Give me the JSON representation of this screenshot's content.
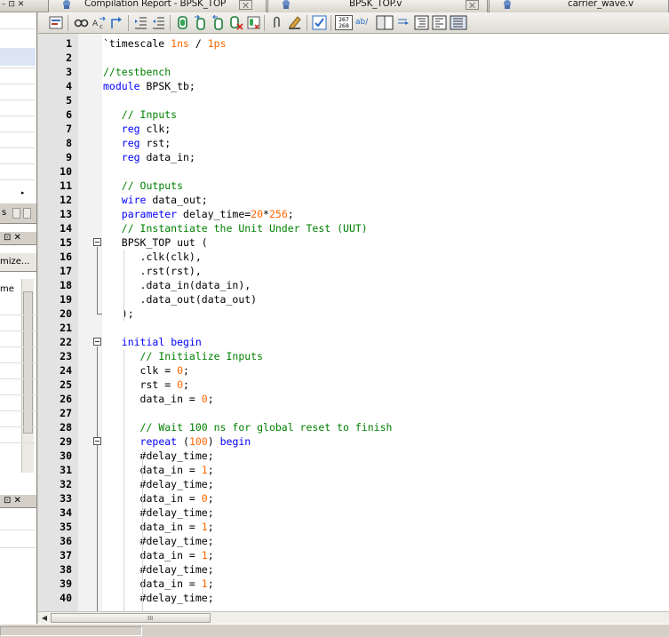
{
  "left_panel": {
    "header_controls": "– ⊡ ✕",
    "tab_fragment": "s",
    "pane2_controls": "⊡ ✕",
    "customize_label": "mize...",
    "column_header": "me",
    "pane3_controls": "⊡ ✕"
  },
  "tabs": [
    {
      "label": "Compilation Report - BPSK_TOP",
      "icon": "report-icon",
      "closable": true
    },
    {
      "label": "BPSK_TOP.v",
      "icon": "verilog-file-icon",
      "closable": true
    },
    {
      "label": "carrier_wave.v",
      "icon": "verilog-file-icon",
      "closable": false
    }
  ],
  "toolbar": {
    "buttons": [
      "insert-template-icon",
      "find-icon",
      "find-replace-icon",
      "goto-line-icon",
      "increase-indent-icon",
      "decrease-indent-icon",
      "bookmark-toggle-icon",
      "bookmark-next-icon",
      "bookmark-prev-icon",
      "bookmark-clear-icon",
      "bookmark-list-icon",
      "attach-icon",
      "comment-icon",
      "check-syntax-icon",
      "line-numbers-icon",
      "spell-check-icon",
      "split-view-icon",
      "wrap-icon",
      "indent-guide-icon",
      "view-mode-icon"
    ],
    "line_numbers_top": "267",
    "line_numbers_bottom": "268",
    "spell_label": "ab/"
  },
  "editor": {
    "lines": [
      [
        [
          "plain",
          "`timescale "
        ],
        [
          "num",
          "1ns"
        ],
        [
          "plain",
          " / "
        ],
        [
          "num",
          "1ps"
        ]
      ],
      [],
      [
        [
          "cm",
          "//testbench"
        ]
      ],
      [
        [
          "kw",
          "module"
        ],
        [
          "plain",
          " BPSK_tb;"
        ]
      ],
      [],
      [
        [
          "plain",
          "   "
        ],
        [
          "cm",
          "// Inputs"
        ]
      ],
      [
        [
          "plain",
          "   "
        ],
        [
          "kw",
          "reg"
        ],
        [
          "plain",
          " clk;"
        ]
      ],
      [
        [
          "plain",
          "   "
        ],
        [
          "kw",
          "reg"
        ],
        [
          "plain",
          " rst;"
        ]
      ],
      [
        [
          "plain",
          "   "
        ],
        [
          "kw",
          "reg"
        ],
        [
          "plain",
          " data_in;"
        ]
      ],
      [],
      [
        [
          "plain",
          "   "
        ],
        [
          "cm",
          "// Outputs"
        ]
      ],
      [
        [
          "plain",
          "   "
        ],
        [
          "kw",
          "wire"
        ],
        [
          "plain",
          " data_out;"
        ]
      ],
      [
        [
          "plain",
          "   "
        ],
        [
          "kw",
          "parameter"
        ],
        [
          "plain",
          " delay_time="
        ],
        [
          "num",
          "20"
        ],
        [
          "plain",
          "*"
        ],
        [
          "num",
          "256"
        ],
        [
          "plain",
          ";"
        ]
      ],
      [
        [
          "plain",
          "   "
        ],
        [
          "cm",
          "// Instantiate the Unit Under Test (UUT)"
        ]
      ],
      [
        [
          "plain",
          "   BPSK_TOP uut ("
        ]
      ],
      [
        [
          "plain",
          "      .clk(clk),"
        ]
      ],
      [
        [
          "plain",
          "      .rst(rst),"
        ]
      ],
      [
        [
          "plain",
          "      .data_in(data_in),"
        ]
      ],
      [
        [
          "plain",
          "      .data_out(data_out)"
        ]
      ],
      [
        [
          "plain",
          "   );"
        ]
      ],
      [],
      [
        [
          "plain",
          "   "
        ],
        [
          "kw",
          "initial"
        ],
        [
          "plain",
          " "
        ],
        [
          "kw",
          "begin"
        ]
      ],
      [
        [
          "plain",
          "      "
        ],
        [
          "cm",
          "// Initialize Inputs"
        ]
      ],
      [
        [
          "plain",
          "      clk = "
        ],
        [
          "num",
          "0"
        ],
        [
          "plain",
          ";"
        ]
      ],
      [
        [
          "plain",
          "      rst = "
        ],
        [
          "num",
          "0"
        ],
        [
          "plain",
          ";"
        ]
      ],
      [
        [
          "plain",
          "      data_in = "
        ],
        [
          "num",
          "0"
        ],
        [
          "plain",
          ";"
        ]
      ],
      [],
      [
        [
          "plain",
          "      "
        ],
        [
          "cm",
          "// Wait 100 ns for global reset to finish"
        ]
      ],
      [
        [
          "plain",
          "      "
        ],
        [
          "kw",
          "repeat"
        ],
        [
          "plain",
          " ("
        ],
        [
          "num",
          "100"
        ],
        [
          "plain",
          ") "
        ],
        [
          "kw",
          "begin"
        ]
      ],
      [
        [
          "plain",
          "      #delay_time;"
        ]
      ],
      [
        [
          "plain",
          "      data_in = "
        ],
        [
          "num",
          "1"
        ],
        [
          "plain",
          ";"
        ]
      ],
      [
        [
          "plain",
          "      #delay_time;"
        ]
      ],
      [
        [
          "plain",
          "      data_in = "
        ],
        [
          "num",
          "0"
        ],
        [
          "plain",
          ";"
        ]
      ],
      [
        [
          "plain",
          "      #delay_time;"
        ]
      ],
      [
        [
          "plain",
          "      data_in = "
        ],
        [
          "num",
          "1"
        ],
        [
          "plain",
          ";"
        ]
      ],
      [
        [
          "plain",
          "      #delay_time;"
        ]
      ],
      [
        [
          "plain",
          "      data_in = "
        ],
        [
          "num",
          "1"
        ],
        [
          "plain",
          ";"
        ]
      ],
      [
        [
          "plain",
          "      #delay_time;"
        ]
      ],
      [
        [
          "plain",
          "      data_in = "
        ],
        [
          "num",
          "1"
        ],
        [
          "plain",
          ";"
        ]
      ],
      [
        [
          "plain",
          "      #delay_time;"
        ]
      ]
    ],
    "fold_markers": [
      15,
      22,
      29
    ],
    "colors": {
      "keyword": "#0000ff",
      "comment": "#008000",
      "number": "#ff6600"
    }
  },
  "hscroll": {
    "grip": "III"
  }
}
